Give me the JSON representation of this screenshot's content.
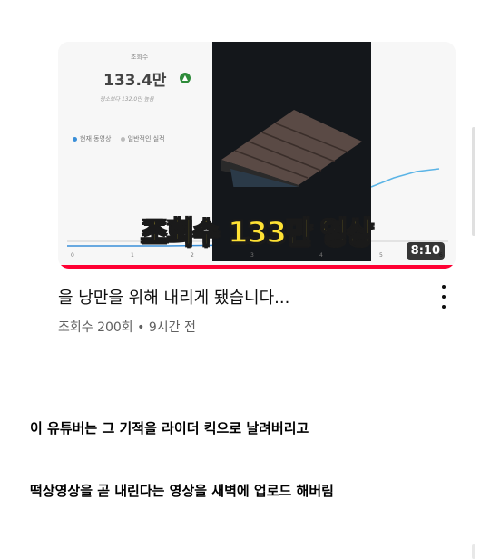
{
  "video": {
    "thumbnail": {
      "stat_label": "조회수",
      "stat_value": "133.4만",
      "stat_sub": "평소보다 132.0만 높음",
      "legend_current": "현재 동영상",
      "legend_typical": "일반적인 실적",
      "x_ticks": [
        "0",
        "1",
        "2",
        "3",
        "4",
        "5",
        "6"
      ],
      "overlay_caption": "조회수 133만 영상",
      "duration": "8:10",
      "watch_progress": 1.0
    },
    "title": "을 낭만을 위해 내리게 됐습니다...",
    "meta": "조회수 200회 • 9시간 전",
    "more_icon": "more-vert-icon"
  },
  "post": {
    "line1": "이 유튜버는 그 기적을 라이더 킥으로 날려버리고",
    "line2": "떡상영상을 곧 내린다는 영상을 새벽에 업로드 해버림"
  },
  "colors": {
    "caption_fill": "#ffe234",
    "progress": "#ff0033",
    "up_badge": "#2e8b3a"
  }
}
